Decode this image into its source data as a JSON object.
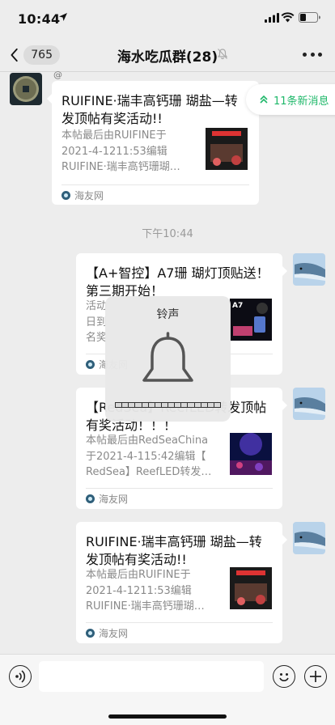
{
  "status": {
    "time": "10:44"
  },
  "nav": {
    "back_count": "765",
    "title": "海水吃瓜群(28)"
  },
  "at_mark": "@",
  "new_messages": "11条新消息",
  "timestamp": "下午10:44",
  "messages": [
    {
      "title": "RUIFINE·瑞丰高钙珊 瑚盐—转发顶帖有奖活动!!",
      "desc": [
        "本帖最后由RUIFINE于",
        "2021-4-1211:53编辑",
        "RUIFINE·瑞丰高钙珊瑚…"
      ],
      "source": "海友网"
    },
    {
      "title": "【A+智控】A7珊 瑚灯顶贴送！第三期开始！",
      "desc": [
        "活动",
        "日到",
        "名奖"
      ],
      "source": "海友网"
    },
    {
      "title": "【RedSea】ReefLED转发顶帖有奖活动！！！",
      "desc": [
        "本帖最后由RedSeaChina",
        "于2021-4-115:42编辑【",
        "RedSea】ReefLED转发…"
      ],
      "source": "海友网"
    },
    {
      "title": "RUIFINE·瑞丰高钙珊 瑚盐—转发顶帖有奖活动!!",
      "desc": [
        "本帖最后由RUIFINE于",
        "2021-4-1211:53编辑",
        "RUIFINE·瑞丰高钙珊瑚…"
      ],
      "source": "海友网"
    }
  ],
  "hud": {
    "label": "铃声",
    "level": 0.0
  },
  "colors": {
    "accent_green": "#1fb86a",
    "background": "#ededed"
  }
}
